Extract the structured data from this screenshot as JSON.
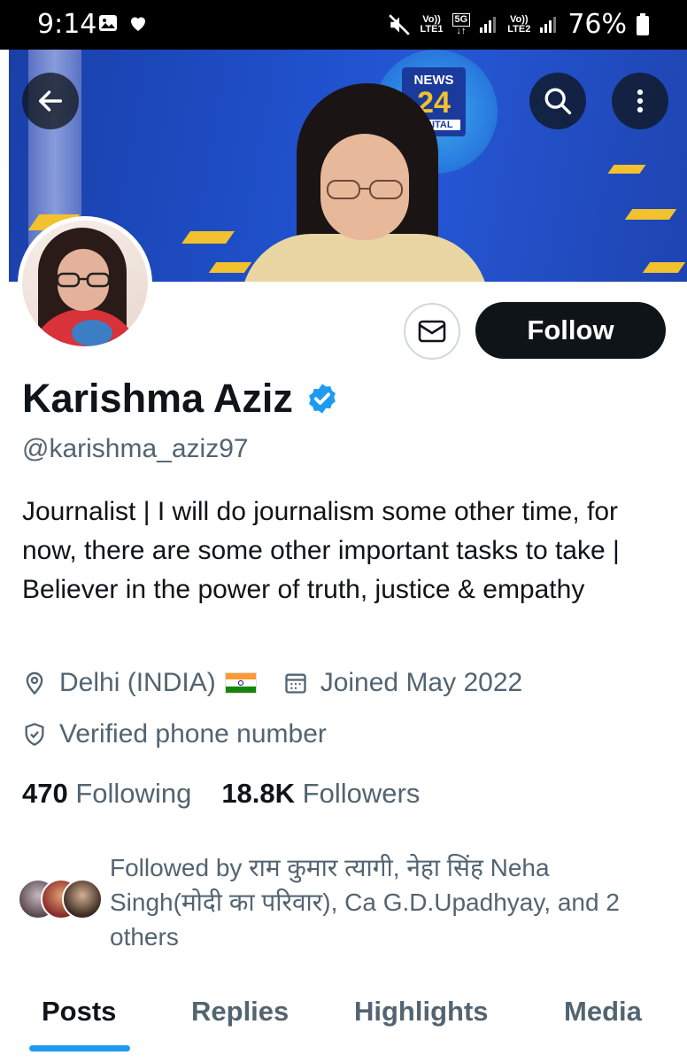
{
  "status_bar": {
    "time": "9:14",
    "left_icons": [
      "image-icon",
      "heart-icon"
    ],
    "net1_top": "Vo))",
    "net1_bottom": "LTE1",
    "net_5g": "5G",
    "net2_top": "Vo))",
    "net2_bottom": "LTE2",
    "battery_percent": "76%"
  },
  "banner": {
    "logo_top": "NEWS",
    "logo_number": "24",
    "logo_bottom": "DIGITAL"
  },
  "profile": {
    "name": "Karishma Aziz",
    "handle": "@karishma_aziz97",
    "verified": true,
    "bio": "Journalist | I will do journalism some other time, for now, there are some other important tasks to take | Believer in the power of truth, justice & empathy",
    "location": "Delhi (INDIA)",
    "joined": "Joined May 2022",
    "verified_phone": "Verified phone number"
  },
  "actions": {
    "follow_label": "Follow"
  },
  "stats": {
    "following_count": "470",
    "following_label": "Following",
    "followers_count": "18.8K",
    "followers_label": "Followers"
  },
  "followed_by": {
    "text": "Followed by राम कुमार त्यागी, नेहा सिंह Neha Singh(मोदी का परिवार), Ca G.D.Upadhyay, and 2 others"
  },
  "tabs": [
    {
      "label": "Posts",
      "active": true
    },
    {
      "label": "Replies",
      "active": false
    },
    {
      "label": "Highlights",
      "active": false
    },
    {
      "label": "Media",
      "active": false
    }
  ],
  "colors": {
    "accent": "#1d9bf0",
    "text_primary": "#0f1419",
    "text_secondary": "#536471",
    "follow_bg": "#0f1419"
  }
}
